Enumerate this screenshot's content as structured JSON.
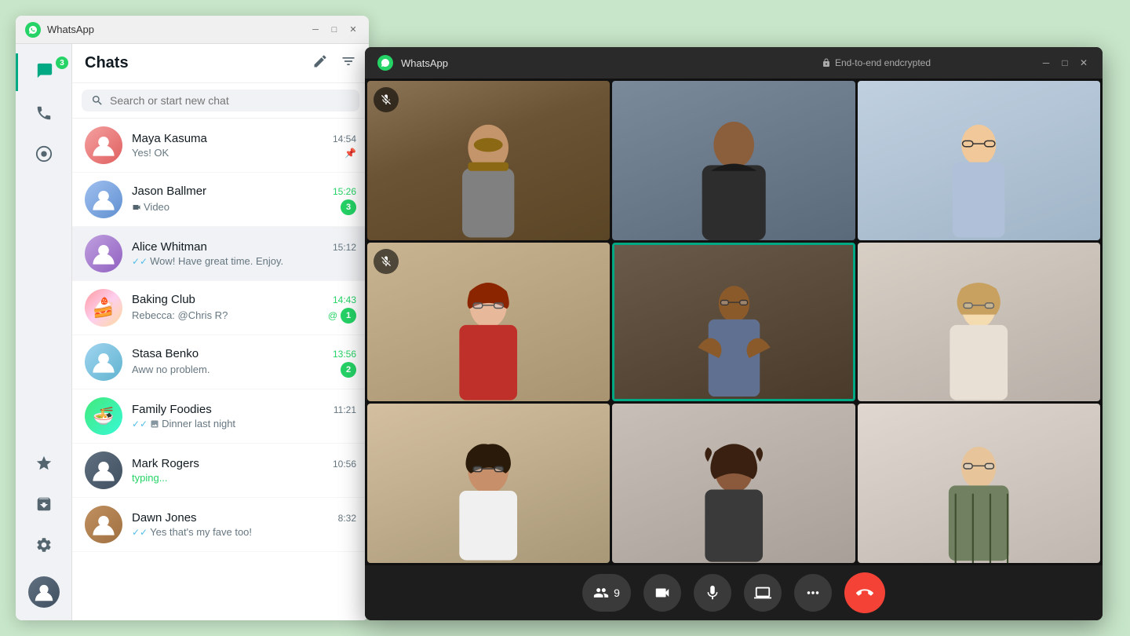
{
  "app": {
    "title": "WhatsApp",
    "encryption_label": "End-to-end endcrypted"
  },
  "window": {
    "title": "WhatsApp"
  },
  "sidebar": {
    "chat_badge": "3",
    "items": [
      {
        "name": "chats",
        "icon": "💬",
        "active": true,
        "badge": "3"
      },
      {
        "name": "calls",
        "icon": "📞"
      },
      {
        "name": "status",
        "icon": "⊙"
      }
    ]
  },
  "chat_panel": {
    "title": "Chats",
    "new_chat_icon": "✏",
    "filter_icon": "☰",
    "search_placeholder": "Search or start new chat"
  },
  "chats": [
    {
      "name": "Maya Kasuma",
      "preview": "Yes! OK",
      "time": "14:54",
      "pinned": true,
      "unread": 0,
      "avatar_class": "avatar-maya",
      "read": true
    },
    {
      "name": "Jason Ballmer",
      "preview": "Video",
      "time": "15:26",
      "unread": 3,
      "avatar_class": "avatar-jason",
      "read": false,
      "has_video": true
    },
    {
      "name": "Alice Whitman",
      "preview": "Wow! Have great time. Enjoy.",
      "time": "15:12",
      "unread": 0,
      "avatar_class": "avatar-alice",
      "active": true,
      "double_check": true
    },
    {
      "name": "Baking Club",
      "preview": "Rebecca: @Chris R?",
      "time": "14:43",
      "unread": 1,
      "avatar_class": "avatar-baking",
      "mention": true
    },
    {
      "name": "Stasa Benko",
      "preview": "Aww no problem.",
      "time": "13:56",
      "unread": 2,
      "avatar_class": "avatar-stasa"
    },
    {
      "name": "Family Foodies",
      "preview": "Dinner last night",
      "time": "11:21",
      "unread": 0,
      "avatar_class": "avatar-family",
      "double_check": true,
      "has_image": true
    },
    {
      "name": "Mark Rogers",
      "preview": "typing...",
      "time": "10:56",
      "unread": 0,
      "avatar_class": "avatar-mark",
      "typing": true
    },
    {
      "name": "Dawn Jones",
      "preview": "Yes that's my fave too!",
      "time": "8:32",
      "unread": 0,
      "avatar_class": "avatar-dawn",
      "double_check": true
    }
  ],
  "call": {
    "participants_count": "9",
    "controls": [
      {
        "name": "participants",
        "icon": "👥",
        "label": "9"
      },
      {
        "name": "video",
        "icon": "📹"
      },
      {
        "name": "mute",
        "icon": "🎤"
      },
      {
        "name": "share-screen",
        "icon": "⬆"
      },
      {
        "name": "more",
        "icon": "•••"
      },
      {
        "name": "end-call",
        "icon": "📞"
      }
    ]
  }
}
